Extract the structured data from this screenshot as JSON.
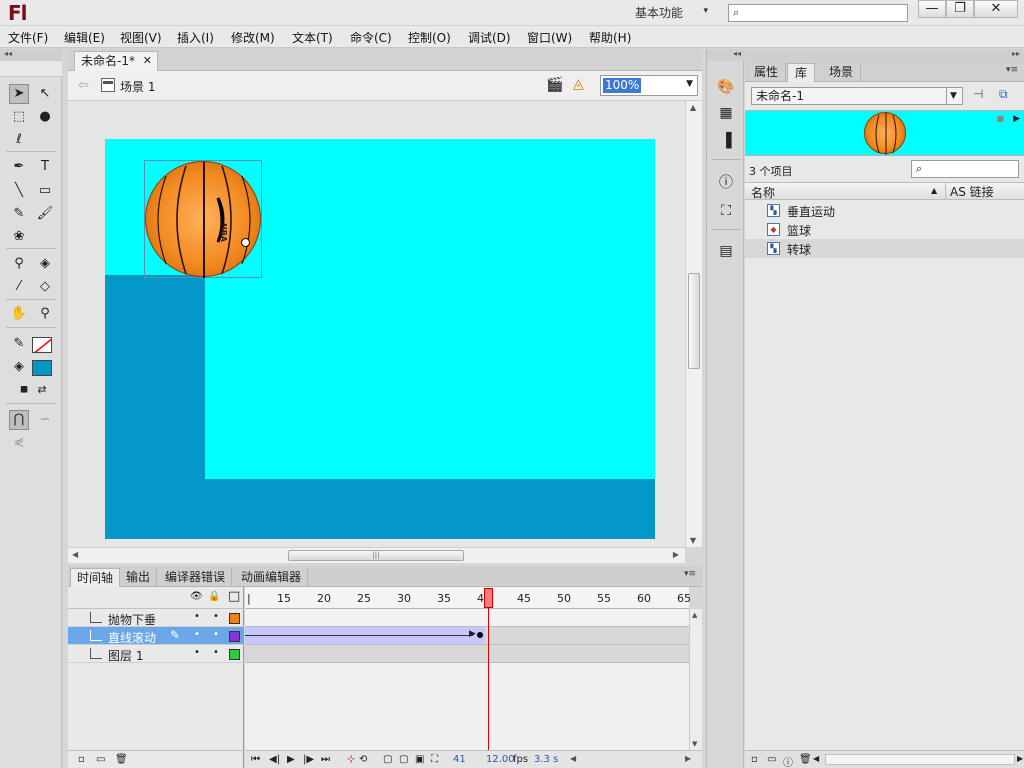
{
  "app": {
    "logo": "Fl",
    "workspace": "基本功能",
    "search_placeholder": ""
  },
  "window_controls": {
    "minimize": "—",
    "maximize": "❐",
    "close": "✕"
  },
  "menu": [
    "文件(F)",
    "编辑(E)",
    "视图(V)",
    "插入(I)",
    "修改(M)",
    "文本(T)",
    "命令(C)",
    "控制(O)",
    "调试(D)",
    "窗口(W)",
    "帮助(H)"
  ],
  "tools": [
    {
      "name": "selection-tool",
      "icon": "arrow-icon",
      "glyph": "➤",
      "active": true
    },
    {
      "name": "subselection-tool",
      "icon": "subselect-icon",
      "glyph": "↖"
    },
    {
      "name": "free-transform-tool",
      "icon": "transform-icon",
      "glyph": "⬚"
    },
    {
      "name": "3d-rotation-tool",
      "icon": "sphere-icon",
      "glyph": "●"
    },
    {
      "name": "lasso-tool",
      "icon": "lasso-icon",
      "glyph": "ℓ"
    },
    {
      "name": "pen-tool",
      "icon": "pen-icon",
      "glyph": "✒"
    },
    {
      "name": "text-tool",
      "icon": "text-icon",
      "glyph": "T"
    },
    {
      "name": "line-tool",
      "icon": "line-icon",
      "glyph": "╲"
    },
    {
      "name": "rectangle-tool",
      "icon": "rectangle-icon",
      "glyph": "▭"
    },
    {
      "name": "pencil-tool",
      "icon": "pencil-icon",
      "glyph": "✎"
    },
    {
      "name": "brush-tool",
      "icon": "brush-icon",
      "glyph": "🖌"
    },
    {
      "name": "deco-tool",
      "icon": "deco-icon",
      "glyph": "❀"
    },
    {
      "name": "bone-tool",
      "icon": "bone-icon",
      "glyph": "⚲"
    },
    {
      "name": "paint-bucket-tool",
      "icon": "bucket-icon",
      "glyph": "◈"
    },
    {
      "name": "eyedropper-tool",
      "icon": "eyedropper-icon",
      "glyph": "⁄"
    },
    {
      "name": "eraser-tool",
      "icon": "eraser-icon",
      "glyph": "◇"
    },
    {
      "name": "hand-tool",
      "icon": "hand-icon",
      "glyph": "✋"
    },
    {
      "name": "zoom-tool",
      "icon": "magnifier-icon",
      "glyph": "⚲"
    },
    {
      "name": "stroke-color",
      "icon": "stroke-pencil-icon",
      "glyph": "✎"
    },
    {
      "name": "fill-color",
      "icon": "fill-bucket-icon",
      "glyph": "◈"
    },
    {
      "name": "black-white-swatch",
      "icon": "bw-icon",
      "glyph": "◼"
    },
    {
      "name": "swap-colors",
      "icon": "swap-icon",
      "glyph": "⇄"
    },
    {
      "name": "snap-to-objects",
      "icon": "magnet-icon",
      "glyph": "⋂"
    },
    {
      "name": "smooth-option",
      "icon": "smooth-icon",
      "glyph": "∽"
    },
    {
      "name": "straighten-option",
      "icon": "straighten-icon",
      "glyph": "⋞"
    }
  ],
  "colors": {
    "stroke": "#ff0000",
    "fill": "#0498c8",
    "stage": "#00ffff",
    "wall": "#0498c8",
    "ball": "#f28b22"
  },
  "document": {
    "tab_title": "未命名-1*",
    "tab_close": "✕",
    "scene": "场景 1",
    "zoom": "100%"
  },
  "stage_content": {
    "ball_text": "NBA"
  },
  "timeline": {
    "tabs": [
      "时间轴",
      "输出",
      "编译器错误",
      "动画编辑器"
    ],
    "header_icons": {
      "eye": "👁",
      "lock": "🔒",
      "outline": "□"
    },
    "layers": [
      {
        "name": "抛物下垂",
        "color": "#f0820f",
        "selected": false
      },
      {
        "name": "直线滚动",
        "color": "#8a34d8",
        "selected": true
      },
      {
        "name": "图层 1",
        "color": "#2ccc3c",
        "selected": false
      }
    ],
    "ruler_first": "|",
    "ruler": [
      "15",
      "20",
      "25",
      "30",
      "35",
      "40",
      "45",
      "50",
      "55",
      "60",
      "65"
    ],
    "footer": {
      "current_frame": "41",
      "fps": "12.00",
      "fps_unit": "fps",
      "time": "3.3 s"
    }
  },
  "library": {
    "tabs": [
      "属性",
      "库",
      "场景"
    ],
    "document": "未命名-1",
    "item_count": "3 个项目",
    "columns": {
      "name": "名称",
      "linkage": "AS 链接"
    },
    "items": [
      {
        "name": "垂直运动",
        "icon": "movieclip-icon",
        "selected": false
      },
      {
        "name": "篮球",
        "icon": "graphic-icon",
        "selected": false
      },
      {
        "name": "转球",
        "icon": "movieclip-icon",
        "selected": true
      }
    ]
  }
}
